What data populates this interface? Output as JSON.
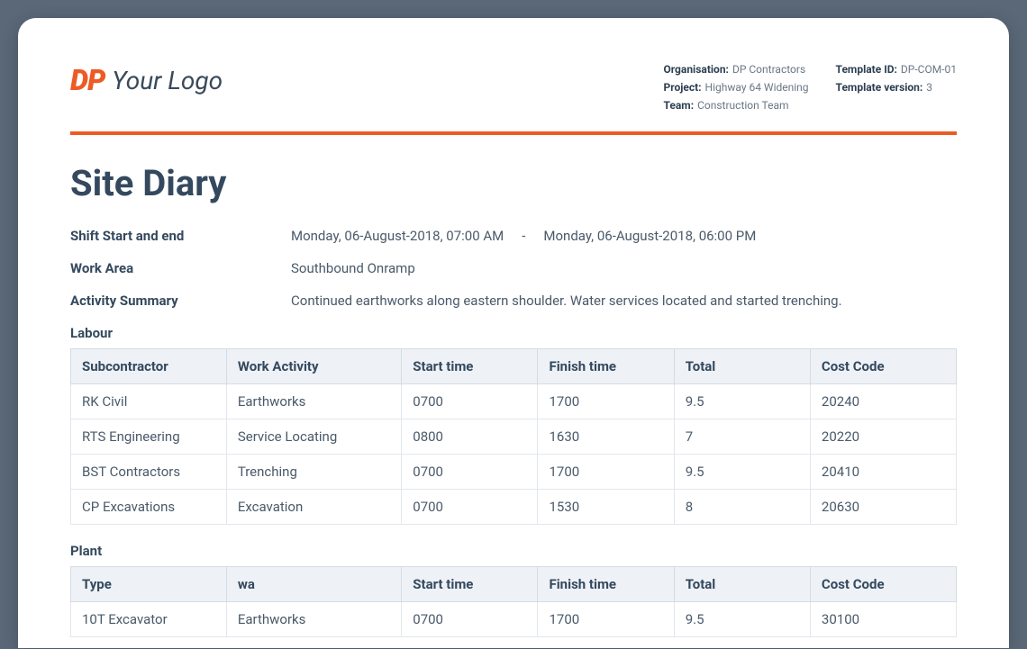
{
  "logo": {
    "mark": "DP",
    "text": "Your Logo"
  },
  "meta": {
    "org_label": "Organisation:",
    "org": "DP Contractors",
    "project_label": "Project:",
    "project": "Highway 64 Widening",
    "team_label": "Team:",
    "team": "Construction Team",
    "template_id_label": "Template ID:",
    "template_id": "DP-COM-01",
    "template_version_label": "Template version:",
    "template_version": "3"
  },
  "title": "Site Diary",
  "fields": {
    "shift_label": "Shift Start and end",
    "shift_start": "Monday, 06-August-2018, 07:00 AM",
    "shift_sep": "-",
    "shift_end": "Monday, 06-August-2018, 06:00 PM",
    "area_label": "Work Area",
    "area_value": "Southbound Onramp",
    "summary_label": "Activity Summary",
    "summary_value": "Continued earthworks along eastern shoulder. Water services located and started trenching."
  },
  "labour": {
    "label": "Labour",
    "headers": [
      "Subcontractor",
      "Work Activity",
      "Start time",
      "Finish time",
      "Total",
      "Cost Code"
    ],
    "rows": [
      [
        "RK Civil",
        "Earthworks",
        "0700",
        "1700",
        "9.5",
        "20240"
      ],
      [
        "RTS Engineering",
        "Service Locating",
        "0800",
        "1630",
        "7",
        "20220"
      ],
      [
        "BST Contractors",
        "Trenching",
        "0700",
        "1700",
        "9.5",
        "20410"
      ],
      [
        "CP Excavations",
        "Excavation",
        "0700",
        "1530",
        "8",
        "20630"
      ]
    ]
  },
  "plant": {
    "label": "Plant",
    "headers": [
      "Type",
      "wa",
      "Start time",
      "Finish time",
      "Total",
      "Cost Code"
    ],
    "rows": [
      [
        "10T Excavator",
        "Earthworks",
        "0700",
        "1700",
        "9.5",
        "30100"
      ]
    ]
  }
}
